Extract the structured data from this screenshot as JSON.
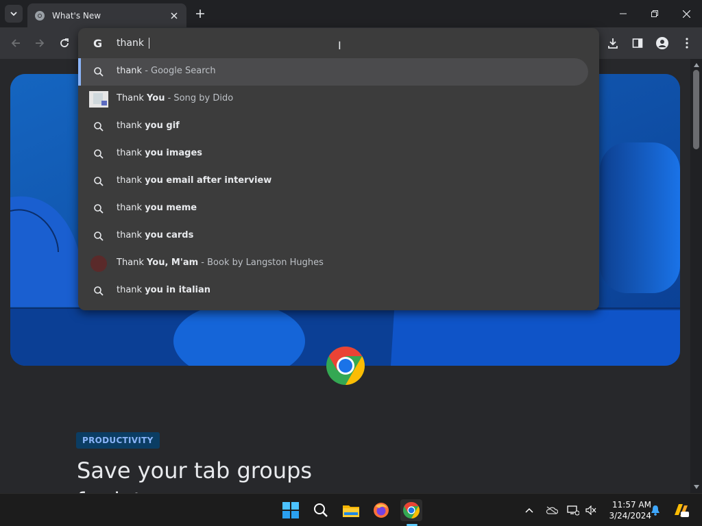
{
  "browser": {
    "tab_title": "What's New",
    "omnibox_text": "thank "
  },
  "suggestions": [
    {
      "type": "search",
      "prefix": "thank",
      "bold": "",
      "desc": " - Google Search",
      "selected": true
    },
    {
      "type": "entity",
      "prefix": "Thank ",
      "bold": "You",
      "desc": " - Song by Dido",
      "selected": false
    },
    {
      "type": "search",
      "prefix": "thank ",
      "bold": "you gif",
      "desc": "",
      "selected": false
    },
    {
      "type": "search",
      "prefix": "thank ",
      "bold": "you images",
      "desc": "",
      "selected": false
    },
    {
      "type": "search",
      "prefix": "thank ",
      "bold": "you email after interview",
      "desc": "",
      "selected": false
    },
    {
      "type": "search",
      "prefix": "thank ",
      "bold": "you meme",
      "desc": "",
      "selected": false
    },
    {
      "type": "search",
      "prefix": "thank ",
      "bold": "you cards",
      "desc": "",
      "selected": false
    },
    {
      "type": "entity",
      "prefix": "Thank ",
      "bold": "You, M'am",
      "desc": " - Book by Langston Hughes",
      "selected": false
    },
    {
      "type": "search",
      "prefix": "thank ",
      "bold": "you in italian",
      "desc": "",
      "selected": false
    }
  ],
  "page": {
    "badge": "PRODUCTIVITY",
    "headline": "Save your tab groups",
    "headline_next_line": "for later"
  },
  "taskbar": {
    "time": "11:57 AM",
    "date": "3/24/2024"
  },
  "colors": {
    "accent": "#8ab4f8",
    "toolbar": "#35363a",
    "omnibox": "#3c3c3c",
    "hero_blue": "#0d47a1"
  }
}
